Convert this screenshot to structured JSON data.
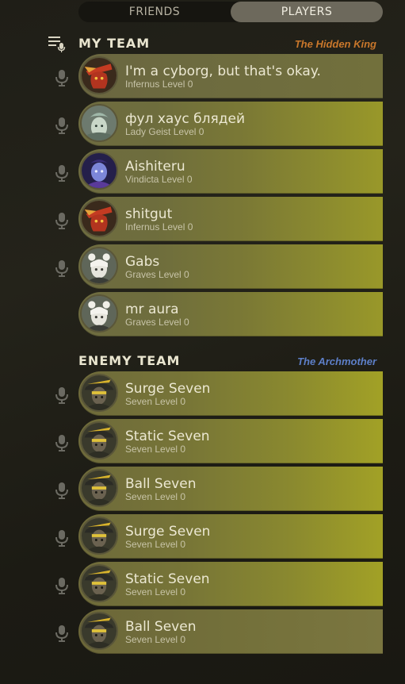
{
  "tabs": [
    {
      "label": "FRIENDS",
      "active": false
    },
    {
      "label": "PLAYERS",
      "active": true
    }
  ],
  "my_team": {
    "title": "MY TEAM",
    "side_label": "The Hidden King",
    "side_color": "#c9772b",
    "players": [
      {
        "name": "I'm a cyborg, but that's okay.",
        "hero": "Infernus",
        "level": "Level 0",
        "mic": true,
        "avatar": "infernus"
      },
      {
        "name": "фул хаус блядей",
        "hero": "Lady Geist",
        "level": "Level 0",
        "mic": true,
        "avatar": "lady-geist"
      },
      {
        "name": "Aishiteru",
        "hero": "Vindicta",
        "level": "Level 0",
        "mic": true,
        "avatar": "vindicta"
      },
      {
        "name": "shitgut",
        "hero": "Infernus",
        "level": "Level 0",
        "mic": true,
        "avatar": "infernus"
      },
      {
        "name": "Gabs",
        "hero": "Graves",
        "level": "Level 0",
        "mic": true,
        "avatar": "graves"
      },
      {
        "name": "mr aura",
        "hero": "Graves",
        "level": "Level 0",
        "mic": false,
        "avatar": "graves"
      }
    ]
  },
  "enemy_team": {
    "title": "ENEMY TEAM",
    "side_label": "The Archmother",
    "side_color": "#5d7fc8",
    "players": [
      {
        "name": "Surge Seven",
        "hero": "Seven",
        "level": "Level 0",
        "mic": true,
        "avatar": "seven"
      },
      {
        "name": "Static Seven",
        "hero": "Seven",
        "level": "Level 0",
        "mic": true,
        "avatar": "seven"
      },
      {
        "name": "Ball Seven",
        "hero": "Seven",
        "level": "Level 0",
        "mic": true,
        "avatar": "seven"
      },
      {
        "name": "Surge Seven",
        "hero": "Seven",
        "level": "Level 0",
        "mic": true,
        "avatar": "seven"
      },
      {
        "name": "Static Seven",
        "hero": "Seven",
        "level": "Level 0",
        "mic": true,
        "avatar": "seven"
      },
      {
        "name": "Ball Seven",
        "hero": "Seven",
        "level": "Level 0",
        "mic": true,
        "avatar": "seven"
      }
    ]
  },
  "icons": {
    "queue": "playlist-mic-icon",
    "mic": "microphone-icon"
  }
}
